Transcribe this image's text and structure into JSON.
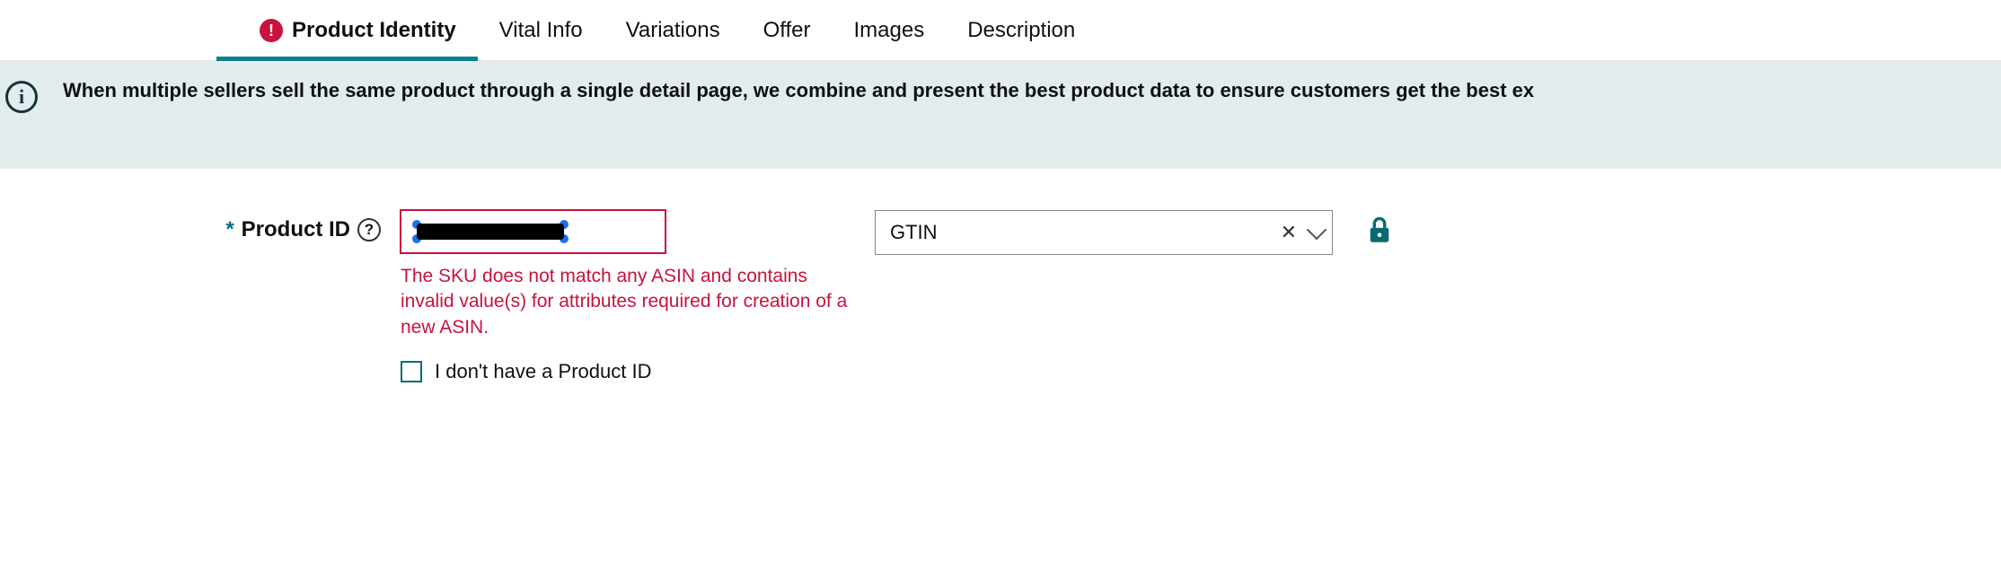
{
  "tabs": {
    "product_identity": "Product Identity",
    "vital_info": "Vital Info",
    "variations": "Variations",
    "offer": "Offer",
    "images": "Images",
    "description": "Description"
  },
  "banner": {
    "text": "When multiple sellers sell the same product through a single detail page, we combine and present the best product data to ensure customers get the best ex"
  },
  "form": {
    "product_id_label": "Product ID",
    "product_id_value": "",
    "product_id_type": "GTIN",
    "error_message": "The SKU does not match any ASIN and contains invalid value(s) for attributes required for creation of a new ASIN.",
    "no_product_id_label": "I don't have a Product ID"
  }
}
